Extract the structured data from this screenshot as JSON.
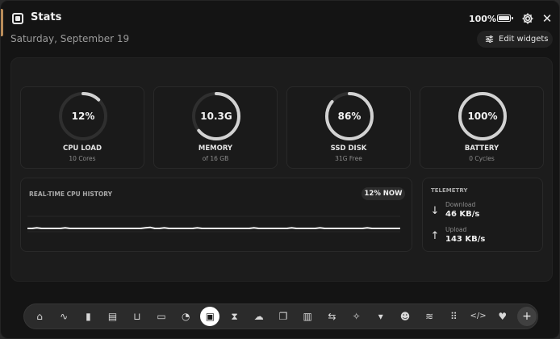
{
  "header": {
    "app_title": "Stats",
    "date": "Saturday, September 19",
    "battery_percent_label": "100%",
    "edit_widgets_label": "Edit widgets"
  },
  "cards": [
    {
      "id": "cpu",
      "value_label": "12%",
      "label": "CPU LOAD",
      "sub": "10 Cores",
      "fraction": 0.12
    },
    {
      "id": "memory",
      "value_label": "10.3G",
      "label": "MEMORY",
      "sub": "of 16 GB",
      "fraction": 0.64
    },
    {
      "id": "disk",
      "value_label": "86%",
      "label": "SSD DISK",
      "sub": "31G Free",
      "fraction": 0.86
    },
    {
      "id": "battery",
      "value_label": "100%",
      "label": "BATTERY",
      "sub": "0 Cycles",
      "fraction": 1.0
    }
  ],
  "history": {
    "title": "REAL-TIME CPU HISTORY",
    "badge": "12% NOW",
    "cpu_percent_series": [
      12,
      12,
      12.5,
      12,
      12,
      12,
      12,
      12,
      12.5,
      12,
      12,
      12,
      12,
      12,
      12,
      12,
      12,
      12,
      12,
      12,
      12,
      12,
      12,
      12,
      12,
      12.5,
      13,
      12,
      12,
      12.5,
      12,
      12,
      12,
      12,
      12,
      12,
      12.5,
      12,
      12,
      12,
      12,
      12,
      12,
      12,
      12,
      12,
      12,
      12,
      12.5,
      12,
      12,
      12,
      12,
      12,
      12,
      12,
      12.5,
      12,
      12,
      12,
      12,
      12,
      12.5,
      12,
      12,
      12,
      12,
      12,
      12,
      12,
      12,
      12,
      12.5,
      12,
      12,
      12,
      12,
      12,
      12,
      12
    ]
  },
  "telemetry": {
    "title": "TELEMETRY",
    "download_label": "Download",
    "download_value": "46 KB/s",
    "upload_label": "Upload",
    "upload_value": "143 KB/s"
  },
  "dock": {
    "items": [
      {
        "icon": "home-icon",
        "glyph": "⌂"
      },
      {
        "icon": "line-chart-icon",
        "glyph": "∿"
      },
      {
        "icon": "bar-chart-icon",
        "glyph": "▮"
      },
      {
        "icon": "calendar-icon",
        "glyph": "▤"
      },
      {
        "icon": "inbox-icon",
        "glyph": "⊔"
      },
      {
        "icon": "window-icon",
        "glyph": "▭"
      },
      {
        "icon": "timer-icon",
        "glyph": "◔"
      },
      {
        "icon": "cpu-icon",
        "glyph": "▣",
        "active": true
      },
      {
        "icon": "hourglass-icon",
        "glyph": "⧗"
      },
      {
        "icon": "weather-icon",
        "glyph": "☁"
      },
      {
        "icon": "documents-icon",
        "glyph": "❐"
      },
      {
        "icon": "book-icon",
        "glyph": "▥"
      },
      {
        "icon": "transfer-icon",
        "glyph": "⇆"
      },
      {
        "icon": "magic-wand-icon",
        "glyph": "✧"
      },
      {
        "icon": "bookmark-icon",
        "glyph": "▾"
      },
      {
        "icon": "smiley-icon",
        "glyph": "☻"
      },
      {
        "icon": "audio-wave-icon",
        "glyph": "≋"
      },
      {
        "icon": "grid-icon",
        "glyph": "⠿"
      },
      {
        "icon": "code-icon",
        "glyph": "</>"
      },
      {
        "icon": "heart-icon",
        "glyph": "♥"
      },
      {
        "icon": "plus-icon",
        "glyph": "+",
        "plus": true
      }
    ]
  },
  "colors": {
    "background": "#141414",
    "panel": "#1c1c1c",
    "ring_track": "#2f2f2f",
    "ring_fill": "#cfcfcf",
    "accent_text": "#f2f2f2"
  }
}
